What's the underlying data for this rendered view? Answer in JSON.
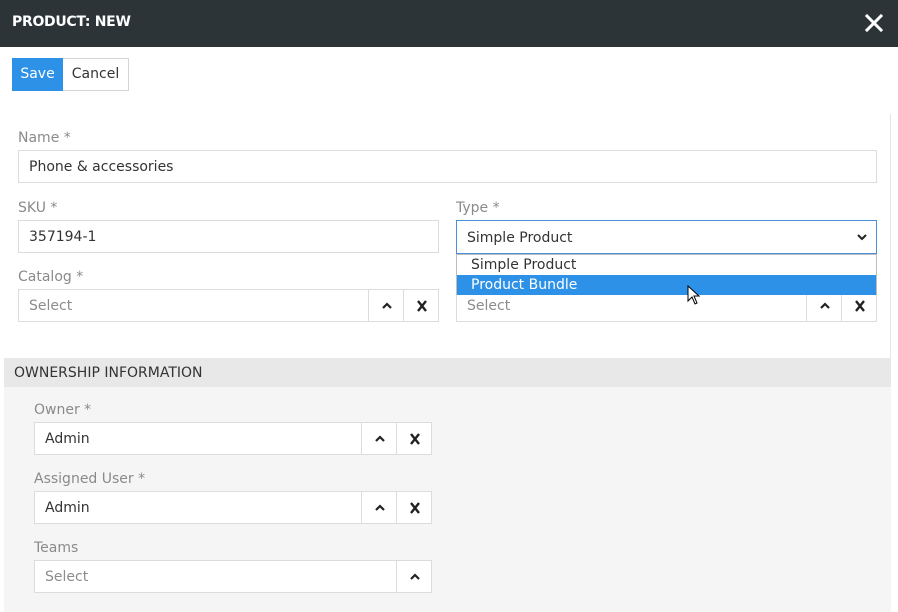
{
  "header": {
    "title": "PRODUCT: NEW",
    "close_icon": "close-icon"
  },
  "toolbar": {
    "save_label": "Save",
    "cancel_label": "Cancel"
  },
  "colors": {
    "header_bg": "#2c3438",
    "accent": "#2e91e8",
    "section_bg": "#f5f5f5"
  },
  "form": {
    "name": {
      "label": "Name *",
      "value": "Phone & accessories"
    },
    "sku": {
      "label": "SKU *",
      "value": "357194-1"
    },
    "type": {
      "label": "Type *",
      "value": "Simple Product",
      "options": [
        "Simple Product",
        "Product Bundle"
      ],
      "highlighted": "Product Bundle"
    },
    "catalog": {
      "label": "Catalog *",
      "placeholder": "Select"
    },
    "hidden_select": {
      "placeholder": "Select"
    }
  },
  "ownership": {
    "title": "OWNERSHIP INFORMATION",
    "owner": {
      "label": "Owner *",
      "value": "Admin"
    },
    "assigned_user": {
      "label": "Assigned User *",
      "value": "Admin"
    },
    "teams": {
      "label": "Teams",
      "placeholder": "Select"
    }
  }
}
